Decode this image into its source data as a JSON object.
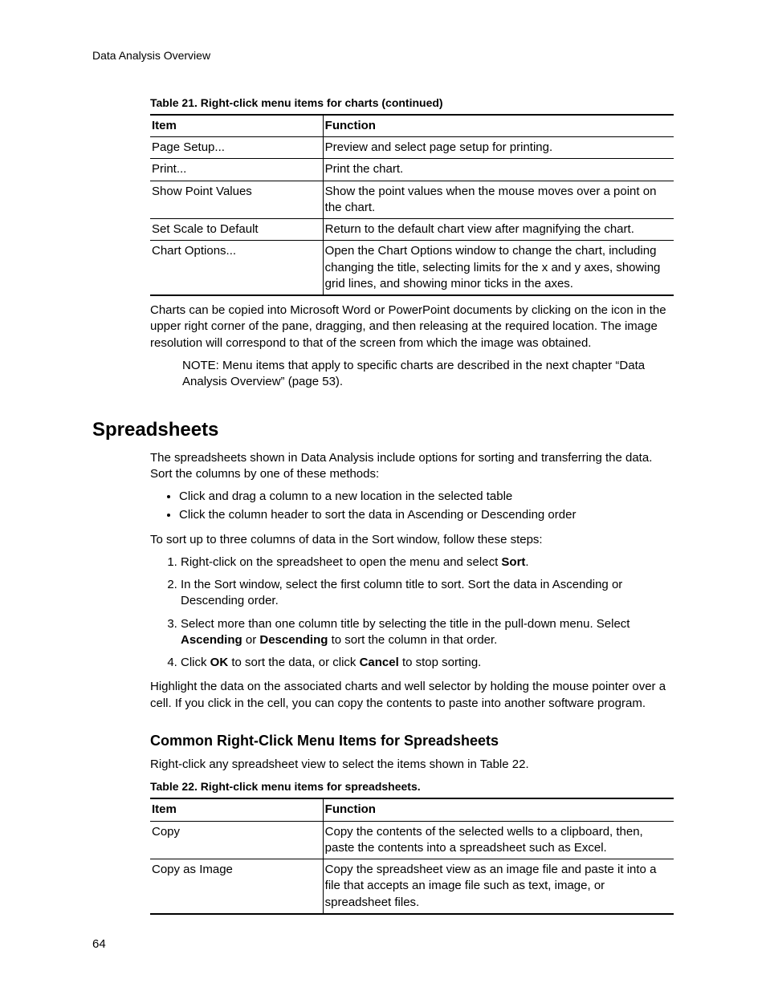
{
  "running_head": "Data Analysis Overview",
  "table21": {
    "caption": "Table 21. Right-click menu items for charts  (continued)",
    "head_item": "Item",
    "head_func": "Function",
    "rows": [
      {
        "item": "Page Setup...",
        "func": "Preview and select page setup for printing."
      },
      {
        "item": "Print...",
        "func": "Print the chart."
      },
      {
        "item": "Show Point Values",
        "func": "Show the point values when the mouse moves over a point on the chart."
      },
      {
        "item": "Set Scale to Default",
        "func": "Return to the default chart view after magnifying the chart."
      },
      {
        "item": "Chart Options...",
        "func": "Open the Chart Options window to change the chart, including changing the title, selecting limits for the x and y axes, showing grid lines, and showing minor ticks in the axes."
      }
    ]
  },
  "para_after_t21": "Charts can be copied into Microsoft Word or PowerPoint documents by clicking on the icon in the upper right corner of the pane, dragging, and then releasing at the required location. The image resolution will correspond to that of the screen from which the image was obtained.",
  "note": "NOTE: Menu items that apply to specific charts are described in the next chapter “Data Analysis Overview” (page 53).",
  "spreadsheets": {
    "heading": "Spreadsheets",
    "intro": "The spreadsheets shown in Data Analysis include options for sorting and transferring the data. Sort the columns by one of these methods:",
    "bullets": [
      "Click and drag a column to a new location in the selected table",
      "Click the column header to sort the data in Ascending or Descending order"
    ],
    "sort_intro": "To sort up to three columns of data in the Sort window, follow these steps:",
    "step1_a": "Right-click on the spreadsheet to open the menu and select ",
    "step1_b": "Sort",
    "step1_c": ".",
    "step2": "In the Sort window, select the first column title to sort. Sort the data in Ascending or Descending order.",
    "step3_a": "Select more than one column title by selecting the title in the pull-down menu. Select ",
    "step3_b": "Ascending",
    "step3_c": " or ",
    "step3_d": "Descending",
    "step3_e": " to sort the column in that order.",
    "step4_a": "Click ",
    "step4_b": "OK",
    "step4_c": " to sort the data, or click ",
    "step4_d": "Cancel",
    "step4_e": " to stop sorting.",
    "highlight_para": "Highlight the data on the associated charts and well selector by holding the mouse pointer over a cell. If you click in the cell, you can copy the contents to paste into another software program."
  },
  "common_menu": {
    "heading": "Common Right-Click Menu Items for Spreadsheets",
    "intro": "Right-click any spreadsheet view to select the items shown in Table 22.",
    "caption": "Table 22. Right-click menu items for spreadsheets."
  },
  "table22": {
    "head_item": "Item",
    "head_func": "Function",
    "rows": [
      {
        "item": "Copy",
        "func": "Copy the contents of the selected wells to a clipboard, then, paste the contents into a spreadsheet such as Excel."
      },
      {
        "item": "Copy as Image",
        "func": "Copy the spreadsheet view as an image file and paste it into a file that accepts an image file such as text, image, or spreadsheet files."
      }
    ]
  },
  "page_number": "64"
}
